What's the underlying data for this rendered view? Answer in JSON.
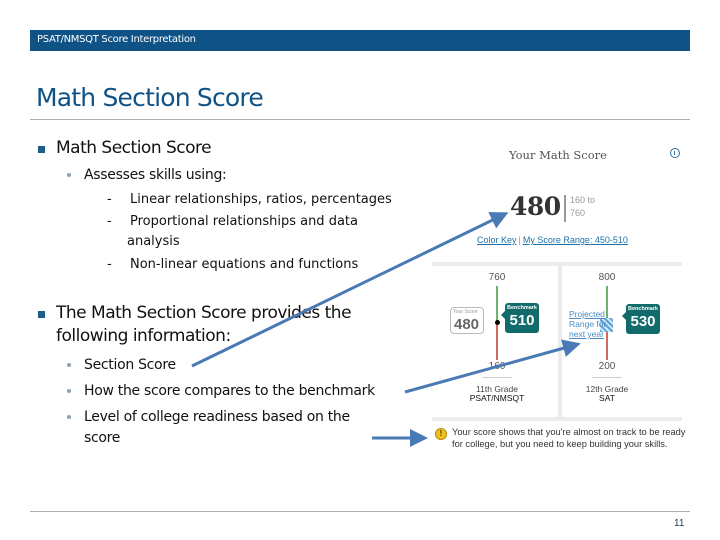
{
  "header": {
    "title": "PSAT/NMSQT Score Interpretation"
  },
  "slide": {
    "title": "Math Section Score",
    "page_number": "11"
  },
  "bullets": {
    "b1": {
      "text": "Math Section Score",
      "sub": {
        "text": "Assesses skills using:",
        "items": [
          "Linear relationships, ratios, percentages",
          "Proportional relationships and data",
          "analysis",
          "Non-linear equations and functions"
        ]
      }
    },
    "b2": {
      "line1": "The Math Section Score provides the",
      "line2": "following information:",
      "items": [
        "Section Score",
        "How the score compares to the benchmark",
        "Level of college readiness based on the",
        "score"
      ]
    },
    "dash": "-"
  },
  "report": {
    "title": "Your Math Score",
    "info_icon": "info-icon",
    "score": "480",
    "range_low": "160 to",
    "range_high": "760",
    "color_key_link": "Color Key",
    "separator": "|",
    "score_range_link": "My Score Range: 450-510",
    "psat": {
      "top": "760",
      "bottom": "160",
      "your_score_label": "Your Score",
      "your_score": "480",
      "benchmark_label": "Benchmark",
      "benchmark": "510",
      "grade": "11th Grade",
      "test": "PSAT/NMSQT"
    },
    "sat": {
      "top": "800",
      "bottom": "200",
      "projected_1": "Projected",
      "projected_2": "Range for",
      "projected_3": "next year",
      "benchmark_label": "Benchmark",
      "benchmark": "530",
      "grade": "12th Grade",
      "test": "SAT"
    },
    "alert_icon_text": "!",
    "alert_message": "Your score shows that you're almost on track to be ready for college, but you need to keep building your skills."
  },
  "colors": {
    "header_bar": "#0f5286",
    "title": "#0f5286",
    "benchmark": "#116b6b",
    "above_benchmark": "#6cb46c",
    "below_benchmark": "#d06a5e",
    "arrow": "#4a7ab5",
    "alert": "#f2c21a"
  }
}
